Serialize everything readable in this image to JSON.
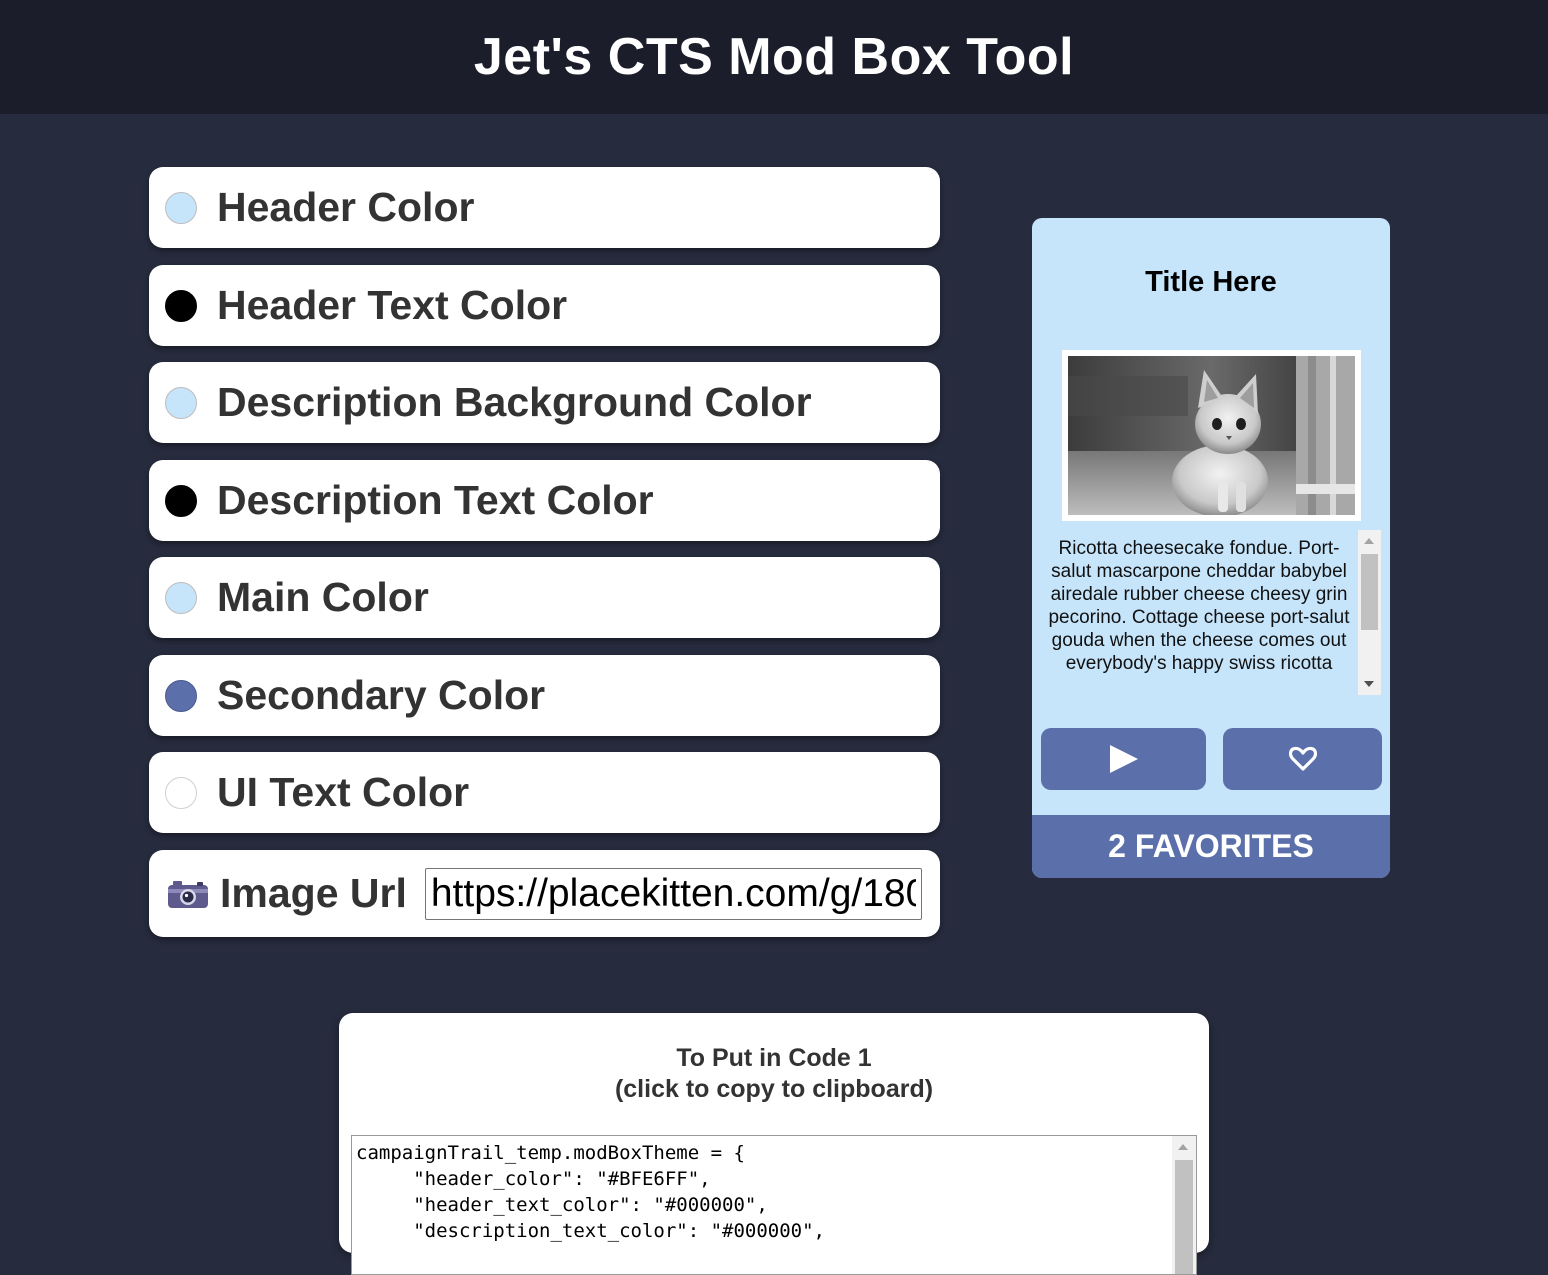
{
  "app": {
    "title": "Jet's CTS Mod Box Tool"
  },
  "settings": [
    {
      "label": "Header Color",
      "color": "#c6e5fb"
    },
    {
      "label": "Header Text Color",
      "color": "#000000"
    },
    {
      "label": "Description Background Color",
      "color": "#c6e5fb"
    },
    {
      "label": "Description Text Color",
      "color": "#000000"
    },
    {
      "label": "Main Color",
      "color": "#c6e5fb"
    },
    {
      "label": "Secondary Color",
      "color": "#5b6faa"
    },
    {
      "label": "UI Text Color",
      "color": "#ffffff"
    }
  ],
  "image_url": {
    "icon": "camera-icon",
    "label": "Image Url",
    "value": "https://placekitten.com/g/180/100"
  },
  "preview": {
    "title": "Title Here",
    "image_alt": "kitten photo",
    "description": "Ricotta cheesecake fondue. Port-salut mascarpone cheddar babybel airedale rubber cheese cheesy grin pecorino. Cottage cheese port-salut gouda when the cheese comes out everybody's happy swiss ricotta",
    "play_icon": "play-icon",
    "favorite_icon": "heart-icon",
    "favorites_text": "2 FAVORITES"
  },
  "code_panel": {
    "heading_line1": "To Put in Code 1",
    "heading_line2": "(click to copy to clipboard)",
    "code": "campaignTrail_temp.modBoxTheme = {\n     \"header_color\": \"#BFE6FF\",\n     \"header_text_color\": \"#000000\",\n     \"description_text_color\": \"#000000\","
  }
}
